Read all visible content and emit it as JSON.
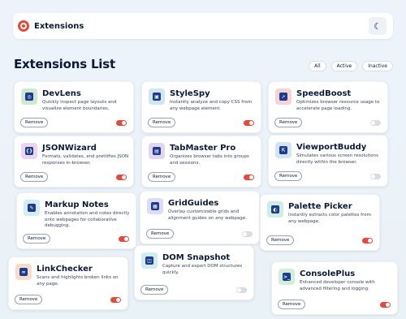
{
  "header": {
    "brand": "Extensions",
    "theme_icon": "moon-icon"
  },
  "list": {
    "title": "Extensions List",
    "filters": [
      "All",
      "Active",
      "Inactive"
    ]
  },
  "remove_label": "Remove",
  "colors": {
    "accent": "#e8483b",
    "toggle_off": "#d9dde3"
  },
  "extensions": [
    {
      "name": "DevLens",
      "desc": "Quickly inspect page layouts and visualize element boundaries.",
      "active": true,
      "icon": "lens-icon",
      "icon_bg": "#cfe8d4"
    },
    {
      "name": "StyleSpy",
      "desc": "Instantly analyze and copy CSS from any webpage element.",
      "active": true,
      "icon": "style-icon",
      "icon_bg": "#cfe7f2"
    },
    {
      "name": "SpeedBoost",
      "desc": "Optimizes browser resource usage to accelerate page loading.",
      "active": false,
      "icon": "rocket-icon",
      "icon_bg": "#f6d3d6"
    },
    {
      "name": "JSONWizard",
      "desc": "Formats, validates, and prettifies JSON responses in-browser.",
      "active": true,
      "icon": "json-icon",
      "icon_bg": "#ecd6ef"
    },
    {
      "name": "TabMaster Pro",
      "desc": "Organizes browser tabs into groups and sessions.",
      "active": true,
      "icon": "tabs-icon",
      "icon_bg": "#e2d6f3"
    },
    {
      "name": "ViewportBuddy",
      "desc": "Simulates various screen resolutions directly within the browser.",
      "active": false,
      "icon": "viewport-icon",
      "icon_bg": "#d4e4f7"
    },
    {
      "name": "Markup Notes",
      "desc": "Enables annotation and notes directly onto webpages for collaborative debugging.",
      "active": true,
      "icon": "notes-icon",
      "icon_bg": "#d3ecf2"
    },
    {
      "name": "GridGuides",
      "desc": "Overlay customizable grids and alignment guides on any webpage.",
      "active": false,
      "icon": "grid-icon",
      "icon_bg": "#dcdcf6"
    },
    {
      "name": "Palette Picker",
      "desc": "Instantly extracts color palettes from any webpage.",
      "active": true,
      "icon": "palette-icon",
      "icon_bg": "#cdeee4"
    },
    {
      "name": "LinkChecker",
      "desc": "Scans and highlights broken links on any page.",
      "active": true,
      "icon": "link-icon",
      "icon_bg": "#f7dccc"
    },
    {
      "name": "DOM Snapshot",
      "desc": "Capture and export DOM structures quickly.",
      "active": false,
      "icon": "snapshot-icon",
      "icon_bg": "#cfecf3"
    },
    {
      "name": "ConsolePlus",
      "desc": "Enhanced developer console with advanced filtering and logging.",
      "active": true,
      "icon": "console-icon",
      "icon_bg": "#cfeedc"
    }
  ]
}
